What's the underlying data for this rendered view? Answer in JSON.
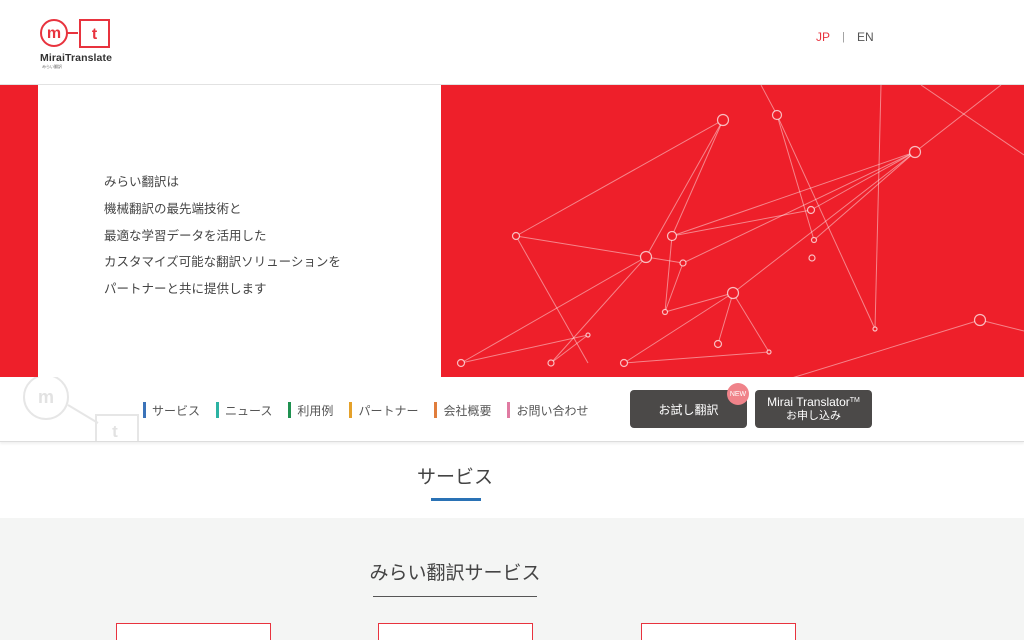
{
  "header": {
    "logo": {
      "letter_m": "m",
      "letter_t": "t",
      "wordmark": "MiraiTranslate",
      "tagline": "みらい翻訳"
    },
    "lang": {
      "jp": "JP",
      "separator": "|",
      "en": "EN"
    }
  },
  "hero": {
    "lines": [
      "みらい翻訳は",
      "機械翻訳の最先端技術と",
      "最適な学習データを活用した",
      "カスタマイズ可能な翻訳ソリューションを",
      "パートナーと共に提供します"
    ]
  },
  "nav": {
    "items": [
      {
        "label": "サービス",
        "color": "#3b73b9"
      },
      {
        "label": "ニュース",
        "color": "#2bb3a3"
      },
      {
        "label": "利用例",
        "color": "#1f9150"
      },
      {
        "label": "パートナー",
        "color": "#e5a12a"
      },
      {
        "label": "会社概要",
        "color": "#e07d3c"
      },
      {
        "label": "お問い合わせ",
        "color": "#e07ba2"
      }
    ],
    "trial_button": "お試し翻訳",
    "new_badge": "NEW",
    "apply_button": {
      "line1": "Mirai Translator",
      "tm": "TM",
      "line2": "お申し込み"
    }
  },
  "section": {
    "title": "サービス"
  },
  "subsection": {
    "title": "みらい翻訳サービス"
  },
  "colors": {
    "brand_red": "#ee1f2a",
    "accent_blue": "#2a72b5",
    "button_dark": "#4b4948"
  }
}
